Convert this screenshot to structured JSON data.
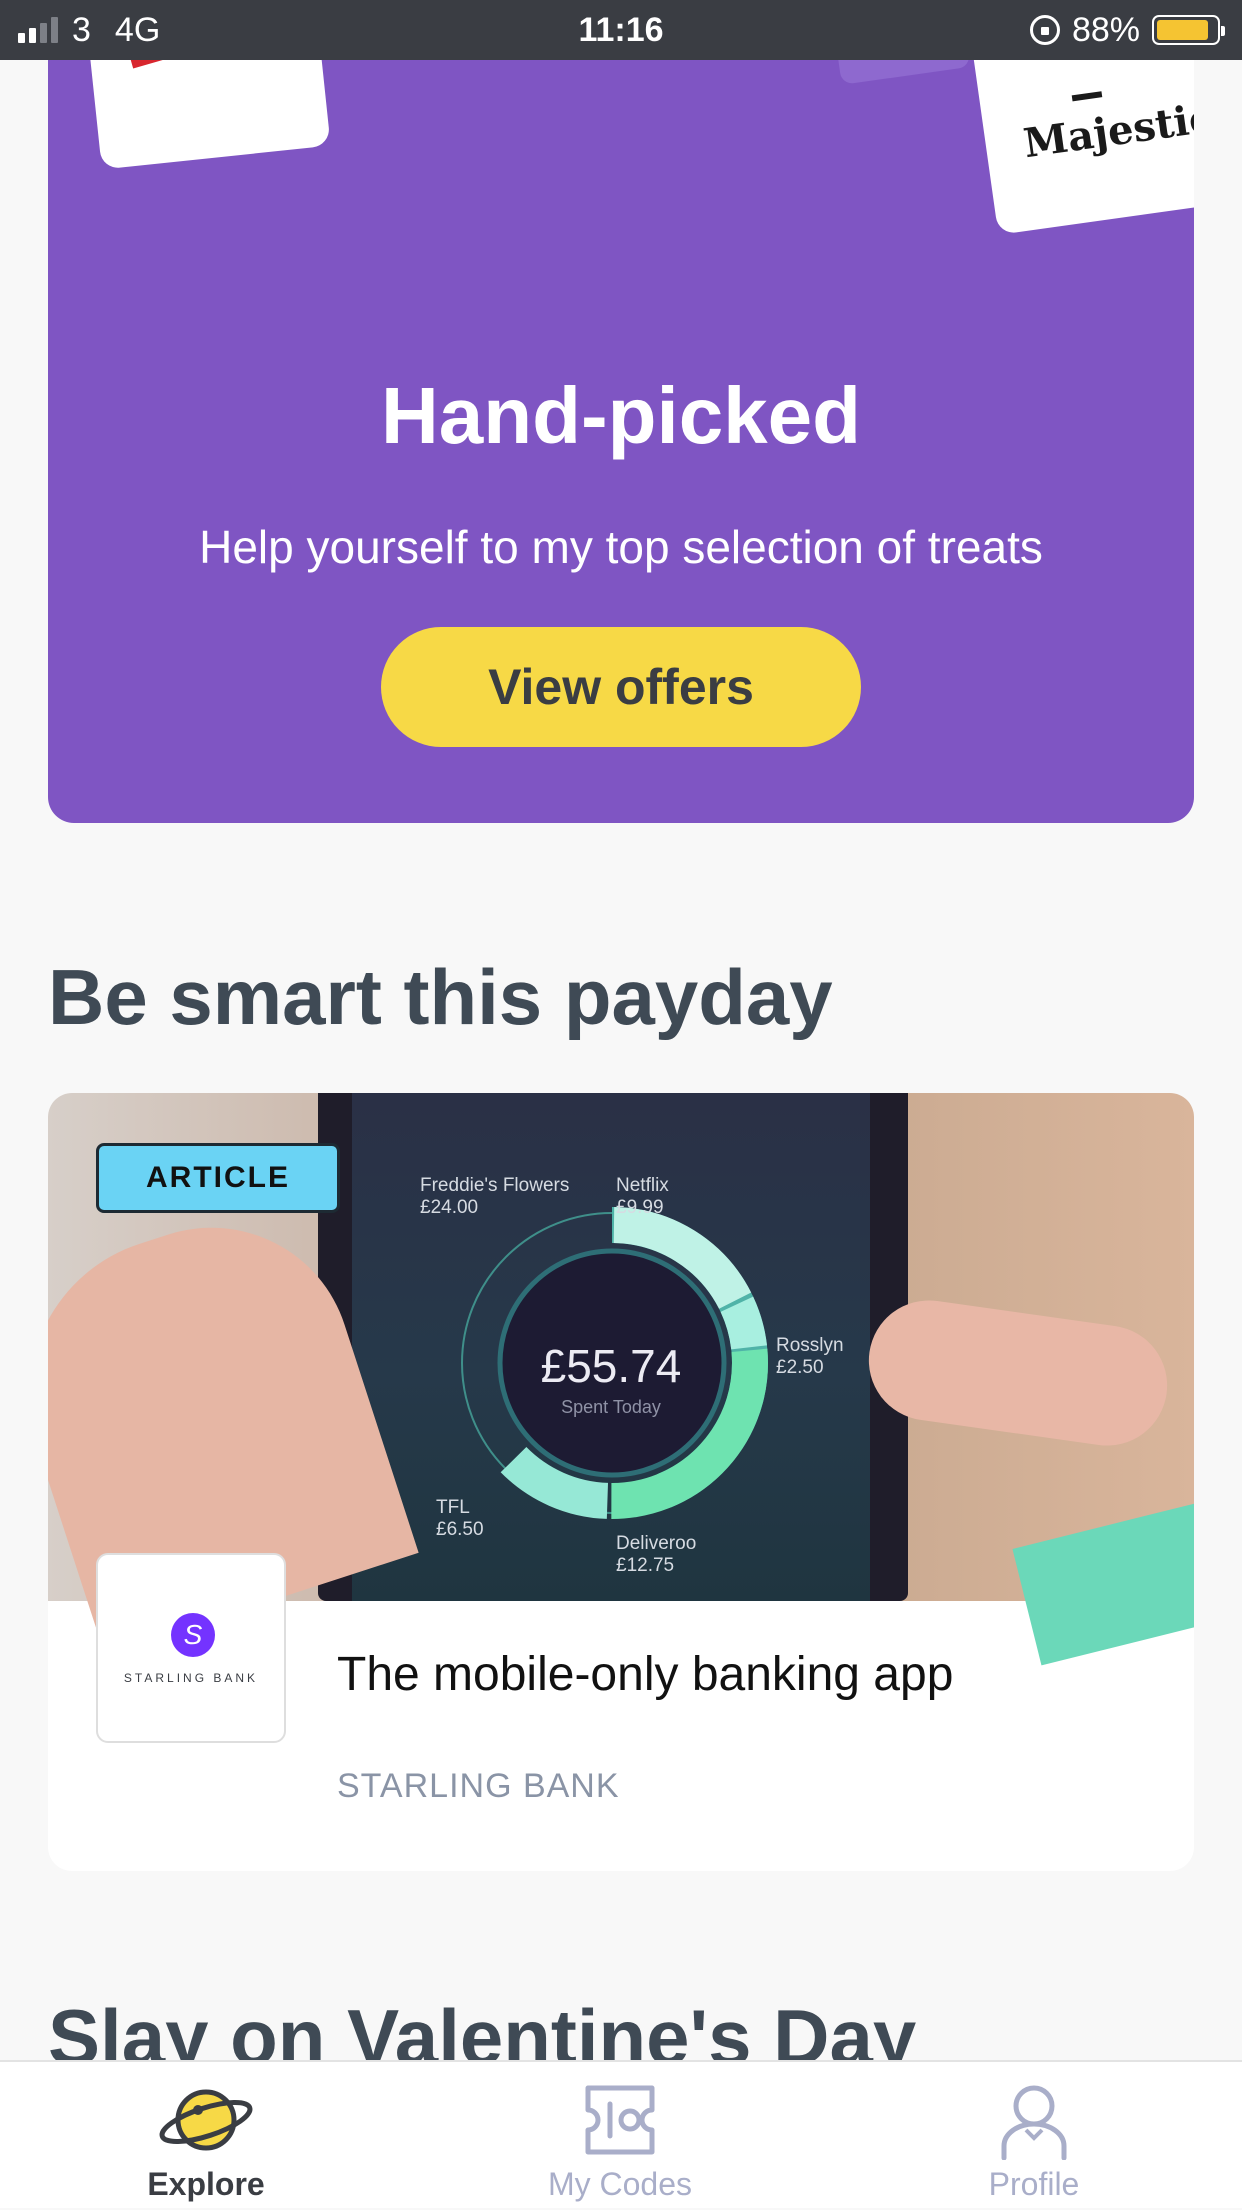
{
  "status_bar": {
    "carrier": "3",
    "network": "4G",
    "time": "11:16",
    "battery_percent": "88%",
    "battery_level": 0.88,
    "signal_bars": 2,
    "icons": [
      "signal-icon",
      "orientation-lock-icon",
      "battery-icon"
    ],
    "battery_color": "#f5c432"
  },
  "hero": {
    "title": "Hand-picked",
    "subtitle": "Help yourself to my top selection of treats",
    "button_label": "View offers",
    "brand_right": "Majestic",
    "background_color": "#7f55c3",
    "button_color": "#f7d946"
  },
  "section_payday": {
    "title": "Be smart this payday",
    "article": {
      "badge": "ARTICLE",
      "title": "The mobile-only banking app",
      "source": "STARLING BANK",
      "logo_text": "STARLING BANK",
      "image": {
        "center_amount": "£55.74",
        "center_caption": "Spent Today",
        "segments": [
          {
            "name": "Freddie's Flowers",
            "amount": "£24.00"
          },
          {
            "name": "Netflix",
            "amount": "£9.99"
          },
          {
            "name": "Rosslyn",
            "amount": "£2.50"
          },
          {
            "name": "TFL",
            "amount": "£6.50"
          },
          {
            "name": "Deliveroo",
            "amount": "£12.75"
          }
        ]
      }
    }
  },
  "section_valentine": {
    "title": "Slay on Valentine's Day"
  },
  "tabbar": {
    "tabs": [
      {
        "label": "Explore",
        "icon": "planet-icon",
        "active": true
      },
      {
        "label": "My Codes",
        "icon": "ticket-icon",
        "active": false
      },
      {
        "label": "Profile",
        "icon": "user-icon",
        "active": false
      }
    ],
    "active_color": "#f7d946",
    "inactive_color": "#a9aec9"
  }
}
